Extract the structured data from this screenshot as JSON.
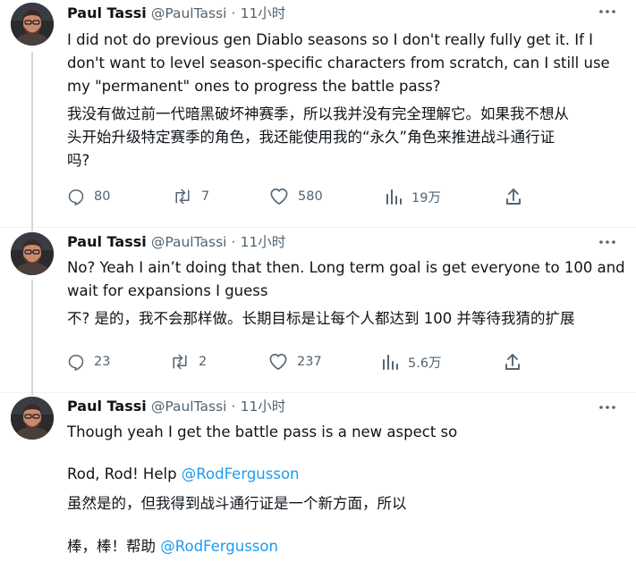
{
  "tweets": [
    {
      "author_name": "Paul Tassi",
      "handle": "@PaulTassi",
      "separator": "·",
      "time": "11小时",
      "lines": [
        "I did not do previous gen Diablo seasons so I don't really fully get it. If I",
        "don't want to level season-specific characters from scratch, can I still use",
        "my \"permanent\" ones to progress the battle pass?"
      ],
      "translation_lines": [
        "我没有做过前一代暗黑破坏神赛季，所以我并没有完全理解它。如果我不想从",
        "头开始升级特定赛季的角色，我还能使用我的“永久”角色来推进战斗通行证",
        "吗?"
      ],
      "replies": "80",
      "retweets": "7",
      "likes": "580",
      "views": "19万"
    },
    {
      "author_name": "Paul Tassi",
      "handle": "@PaulTassi",
      "separator": "·",
      "time": "11小时",
      "lines": [
        "No? Yeah I ain’t doing that then. Long term goal is get everyone to 100 and",
        "wait for expansions I guess"
      ],
      "translation_lines": [
        "不? 是的，我不会那样做。长期目标是让每个人都达到 100 并等待我猜的扩展"
      ],
      "replies": "23",
      "retweets": "2",
      "likes": "237",
      "views": "5.6万"
    },
    {
      "author_name": "Paul Tassi",
      "handle": "@PaulTassi",
      "separator": "·",
      "time": "11小时",
      "line1": "Though yeah I get the battle pass is a new aspect so",
      "line2_text": "Rod, Rod! Help ",
      "line2_mention": "@RodFergusson",
      "translation1": "虽然是的，但我得到战斗通行证是一个新方面，所以",
      "translation2_text": "棒，棒！帮助 ",
      "translation2_mention": "@RodFergusson"
    }
  ],
  "icons": {
    "reply": "reply-icon",
    "retweet": "retweet-icon",
    "like": "heart-icon",
    "views": "views-icon",
    "share": "share-icon",
    "more": "more-icon",
    "avatar": "avatar"
  },
  "colors": {
    "text": "#0f1419",
    "secondary": "#536471",
    "link": "#1d9bf0",
    "divider": "#eff3f4",
    "thread_line": "#cfd9de"
  }
}
